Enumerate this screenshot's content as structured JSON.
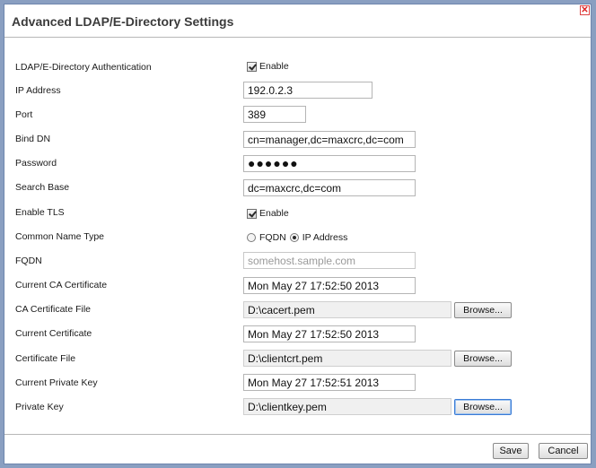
{
  "dialog": {
    "title": "Advanced LDAP/E-Directory Settings",
    "close_glyph": "✕"
  },
  "rows": {
    "auth": {
      "label": "LDAP/E-Directory Authentication",
      "check_label": "Enable",
      "checked": true
    },
    "ip": {
      "label": "IP Address",
      "value": "192.0.2.3"
    },
    "port": {
      "label": "Port",
      "value": "389"
    },
    "bind_dn": {
      "label": "Bind DN",
      "value": "cn=manager,dc=maxcrc,dc=com"
    },
    "password": {
      "label": "Password",
      "value": "●●●●●●"
    },
    "search_base": {
      "label": "Search Base",
      "value": "dc=maxcrc,dc=com"
    },
    "tls": {
      "label": "Enable TLS",
      "check_label": "Enable",
      "checked": true
    },
    "cn_type": {
      "label": "Common Name Type",
      "option_fqdn": "FQDN",
      "option_ip": "IP Address",
      "selected": "IP Address"
    },
    "fqdn": {
      "label": "FQDN",
      "placeholder": "somehost.sample.com"
    },
    "current_ca": {
      "label": "Current CA Certificate",
      "value": "Mon May 27 17:52:50 2013"
    },
    "ca_file": {
      "label": "CA Certificate File",
      "value": "D:\\cacert.pem",
      "browse_label": "Browse..."
    },
    "current_cert": {
      "label": "Current Certificate",
      "value": "Mon May 27 17:52:50 2013"
    },
    "cert_file": {
      "label": "Certificate File",
      "value": "D:\\clientcrt.pem",
      "browse_label": "Browse..."
    },
    "current_key": {
      "label": "Current Private Key",
      "value": "Mon May 27 17:52:51 2013"
    },
    "key_file": {
      "label": "Private Key",
      "value": "D:\\clientkey.pem",
      "browse_label": "Browse..."
    }
  },
  "footer": {
    "save_label": "Save",
    "cancel_label": "Cancel"
  },
  "colors": {
    "background": "#8a9fc1",
    "close_icon": "#dd2222"
  }
}
